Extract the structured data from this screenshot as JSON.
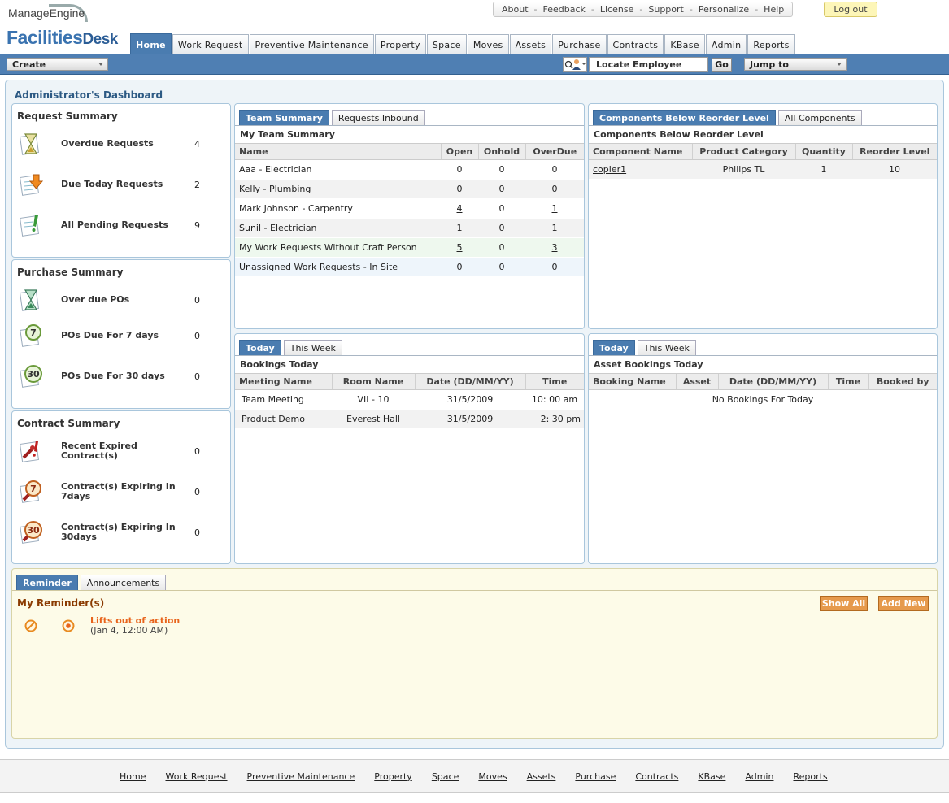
{
  "brand": {
    "company": "ManageEngine",
    "product": "Facilities",
    "product_suffix": "Desk"
  },
  "toplinks": [
    "About",
    "Feedback",
    "License",
    "Support",
    "Personalize",
    "Help"
  ],
  "logout_label": "Log out",
  "tabs": [
    "Home",
    "Work Request",
    "Preventive Maintenance",
    "Property",
    "Space",
    "Moves",
    "Assets",
    "Purchase",
    "Contracts",
    "KBase",
    "Admin",
    "Reports"
  ],
  "active_tab": "Home",
  "navbar": {
    "create_label": "Create",
    "locate_value": "Locate Employee",
    "go_label": "Go",
    "jump_label": "Jump to"
  },
  "dashboard_title": "Administrator's Dashboard",
  "request_summary": {
    "title": "Request Summary",
    "items": [
      {
        "label": "Overdue Requests",
        "value": "4",
        "icon": "hourglass-icon"
      },
      {
        "label": "Due Today Requests",
        "value": "2",
        "icon": "due-today-icon"
      },
      {
        "label": "All Pending Requests",
        "value": "9",
        "icon": "pending-icon"
      }
    ]
  },
  "purchase_summary": {
    "title": "Purchase Summary",
    "items": [
      {
        "label": "Over due POs",
        "value": "0",
        "icon": "hourglass-icon"
      },
      {
        "label": "POs Due For 7 days",
        "value": "0",
        "badge": "7"
      },
      {
        "label": "POs Due For 30 days",
        "value": "0",
        "badge": "30"
      }
    ]
  },
  "contract_summary": {
    "title": "Contract Summary",
    "items": [
      {
        "label": "Recent Expired Contract(s)",
        "value": "0"
      },
      {
        "label": "Contract(s) Expiring In 7days",
        "value": "0",
        "badge": "7"
      },
      {
        "label": "Contract(s) Expiring In 30days",
        "value": "0",
        "badge": "30"
      }
    ]
  },
  "team": {
    "tabs": [
      "Team Summary",
      "Requests Inbound"
    ],
    "subtitle": "My Team Summary",
    "columns": [
      "Name",
      "Open",
      "Onhold",
      "OverDue"
    ],
    "rows": [
      [
        "Aaa - Electrician",
        "0",
        "0",
        "0"
      ],
      [
        "Kelly - Plumbing",
        "0",
        "0",
        "0"
      ],
      [
        "Mark Johnson - Carpentry",
        "4",
        "0",
        "1"
      ],
      [
        "Sunil - Electrician",
        "1",
        "0",
        "1"
      ],
      [
        "My Work Requests Without Craft Person",
        "5",
        "0",
        "3"
      ],
      [
        "Unassigned Work Requests - In Site",
        "0",
        "0",
        "0"
      ]
    ]
  },
  "components": {
    "tabs": [
      "Components Below Reorder Level",
      "All Components"
    ],
    "subtitle": "Components Below Reorder Level",
    "columns": [
      "Component Name",
      "Product Category",
      "Quantity",
      "Reorder Level"
    ],
    "rows": [
      [
        "copier1",
        "Philips TL",
        "1",
        "10"
      ]
    ]
  },
  "bookings": {
    "tabs": [
      "Today",
      "This Week"
    ],
    "subtitle": "Bookings Today",
    "columns": [
      "Meeting Name",
      "Room Name",
      "Date  (DD/MM/YY)",
      "Time"
    ],
    "rows": [
      [
        "Team Meeting",
        "VII - 10",
        "31/5/2009",
        "10: 00 am"
      ],
      [
        "Product Demo",
        "Everest Hall",
        "31/5/2009",
        "2: 30 pm"
      ]
    ]
  },
  "asset_bookings": {
    "tabs": [
      "Today",
      "This Week"
    ],
    "subtitle": "Asset Bookings Today",
    "columns": [
      "Booking Name",
      "Asset",
      "Date  (DD/MM/YY)",
      "Time",
      "Booked by"
    ],
    "empty": "No Bookings For Today"
  },
  "reminder": {
    "tabs": [
      "Reminder",
      "Announcements"
    ],
    "title": "My Reminder(s)",
    "show_all": "Show All",
    "add_new": "Add New",
    "items": [
      {
        "title": "Lifts out of action",
        "date": "(Jan 4, 12:00 AM)"
      }
    ]
  },
  "footer_links": [
    "Home",
    "Work Request",
    "Preventive Maintenance",
    "Property",
    "Space",
    "Moves",
    "Assets",
    "Purchase",
    "Contracts",
    "KBase",
    "Admin",
    "Reports"
  ],
  "colors": {
    "accent": "#4a7cb0",
    "reminder_title": "#8a3a00",
    "reminder_item": "#e8641c",
    "button": "#e69a4c"
  }
}
